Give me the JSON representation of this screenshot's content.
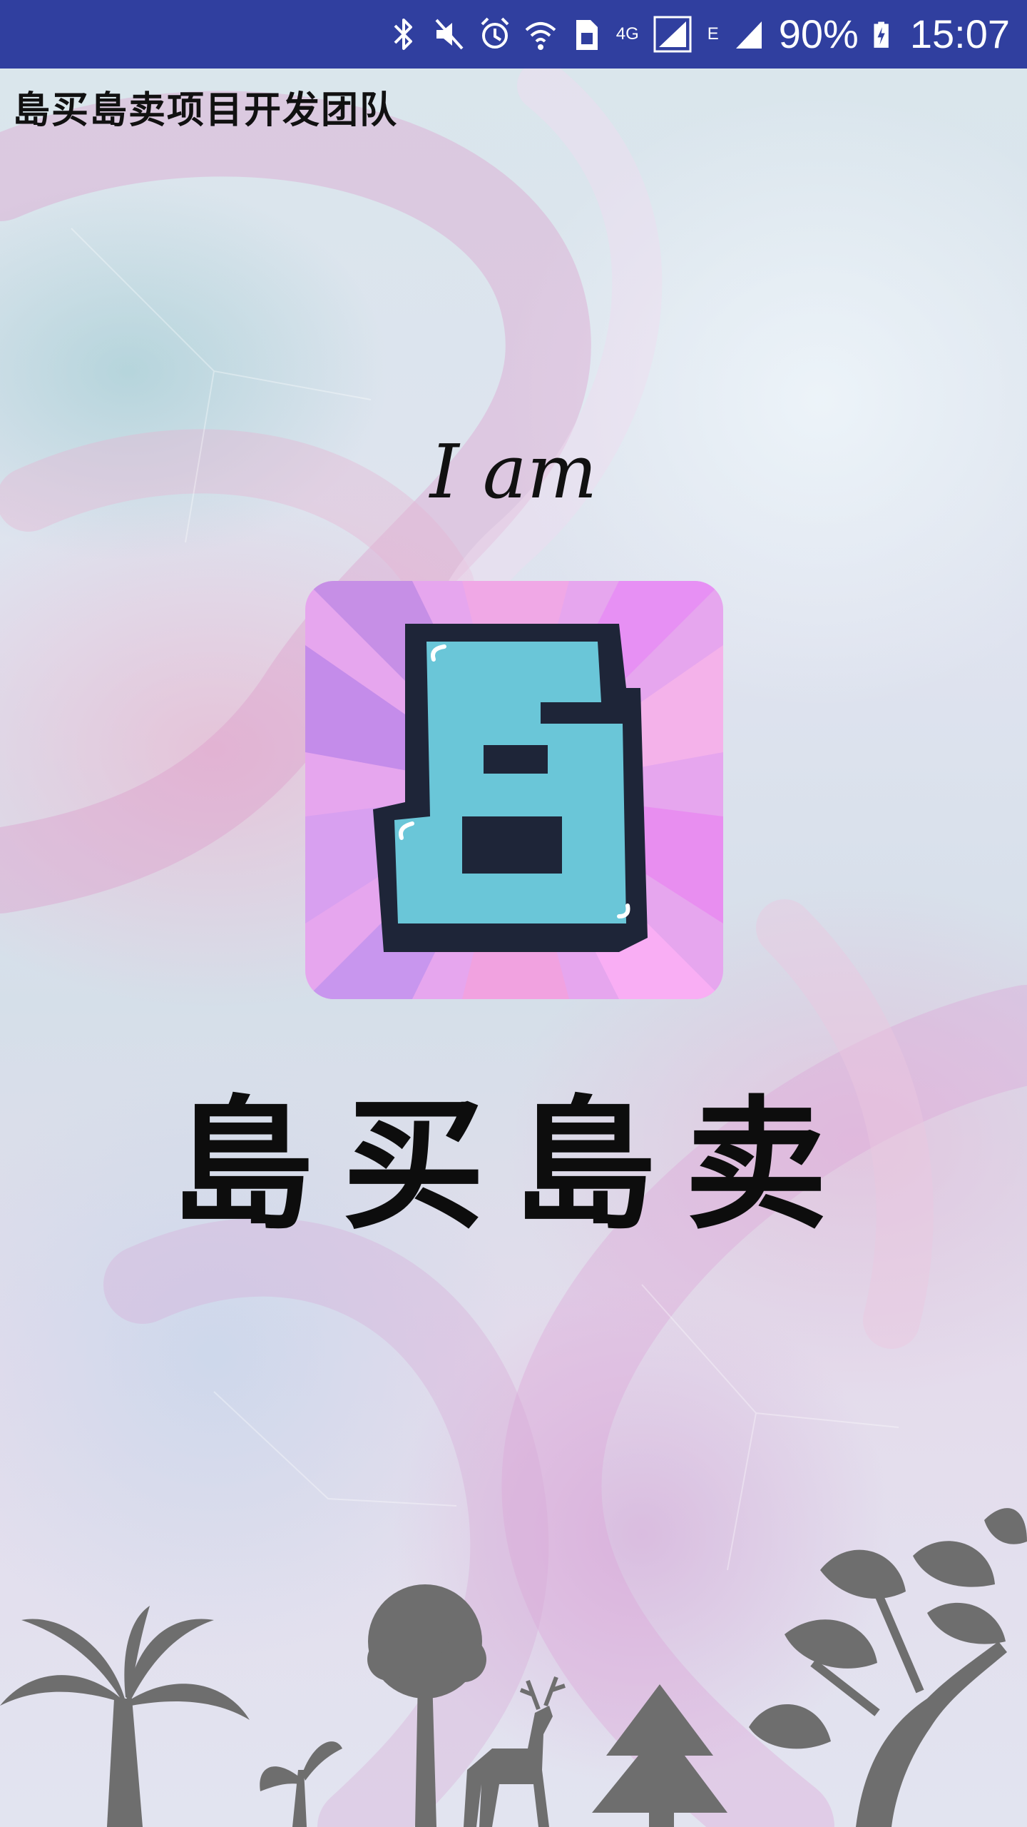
{
  "status_bar": {
    "icons": [
      "bluetooth-icon",
      "mute-icon",
      "alarm-icon",
      "wifi-icon",
      "sim-icon",
      "signal-icon",
      "signal-icon",
      "battery-charging-icon"
    ],
    "network_label": "4G",
    "network_label_2": "E",
    "battery": "90%",
    "time": "15:07",
    "background_color": "#303f9f"
  },
  "header": {
    "team_name": "島买島卖项目开发团队"
  },
  "splash": {
    "greeting": "I am",
    "app_name": "島买島卖",
    "logo_glyph": "島",
    "logo_colors": {
      "rays_primary": "#e89bf0",
      "rays_secondary": "#c990e8",
      "glyph_fill": "#6ac6d8",
      "glyph_outline": "#1e2538"
    }
  },
  "footer": {
    "icons": [
      "palm-tree-icon",
      "sprout-icon",
      "tree-icon",
      "deer-icon",
      "pine-tree-icon",
      "leafy-tree-icon"
    ],
    "silhouette_color": "#6e6e6e"
  }
}
